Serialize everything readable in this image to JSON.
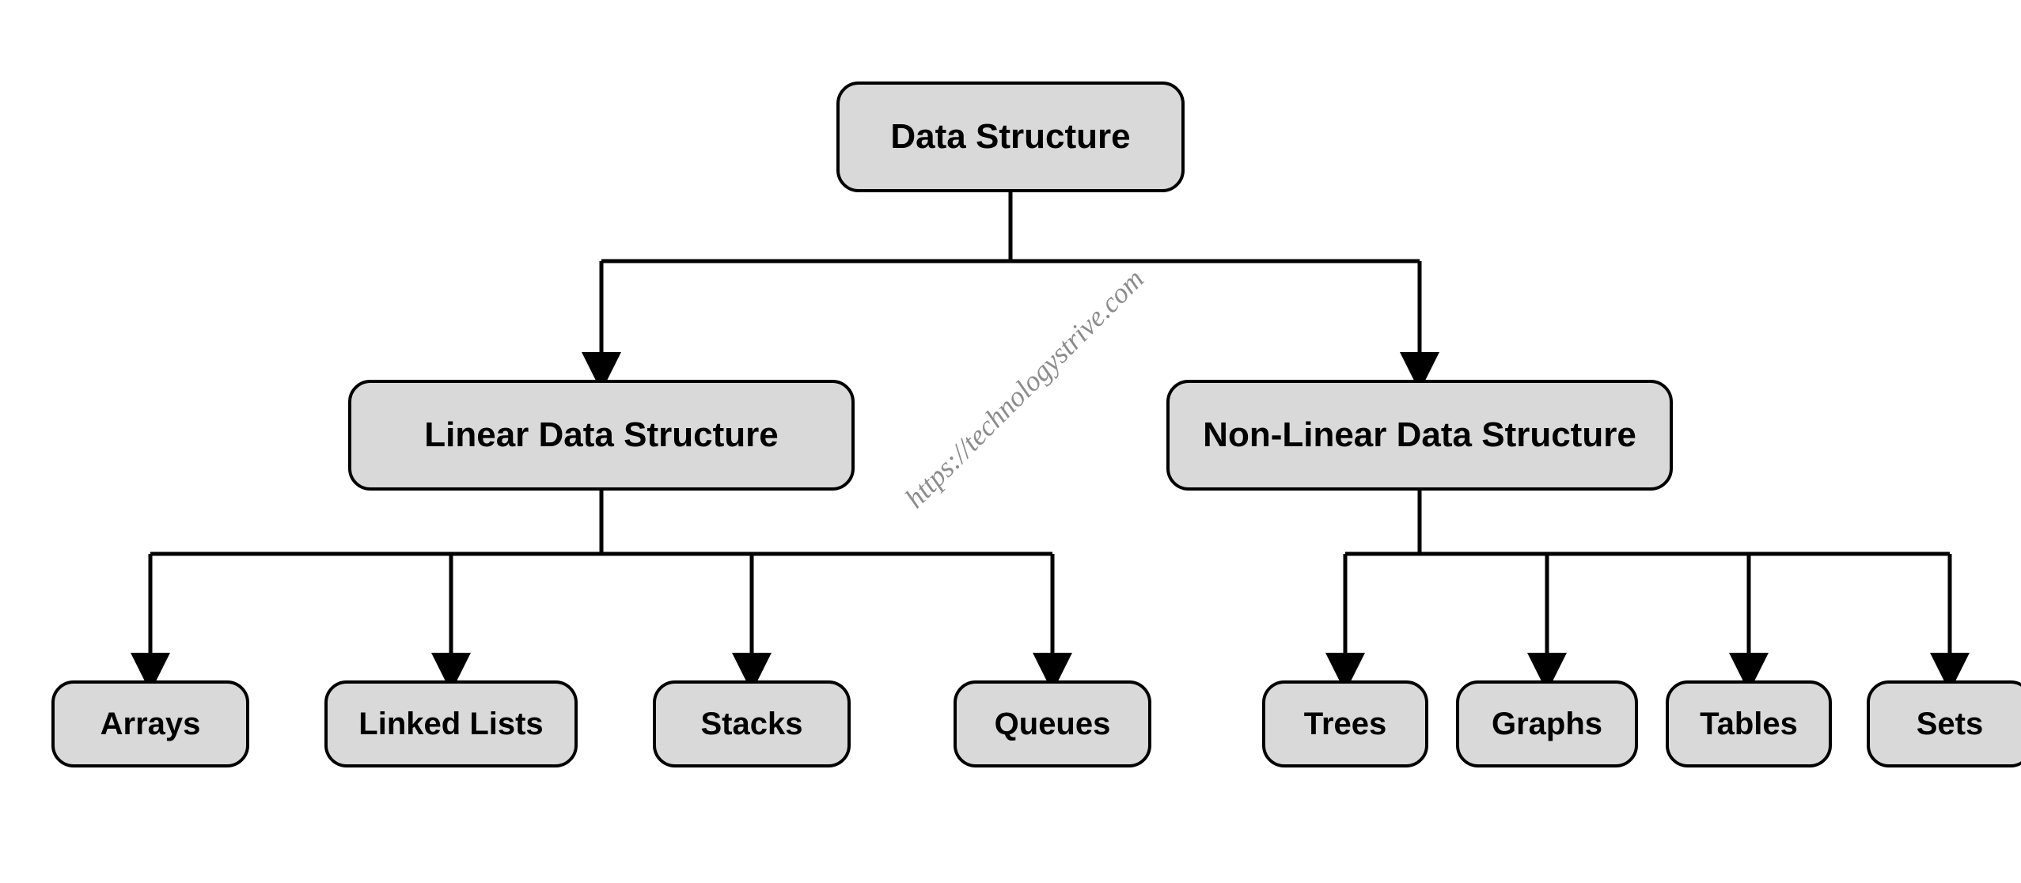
{
  "diagram": {
    "root": {
      "label": "Data Structure"
    },
    "branches": [
      {
        "label": "Linear Data Structure",
        "leaves": [
          {
            "label": "Arrays"
          },
          {
            "label": "Linked Lists"
          },
          {
            "label": "Stacks"
          },
          {
            "label": "Queues"
          }
        ]
      },
      {
        "label": "Non-Linear Data Structure",
        "leaves": [
          {
            "label": "Trees"
          },
          {
            "label": "Graphs"
          },
          {
            "label": "Tables"
          },
          {
            "label": "Sets"
          }
        ]
      }
    ]
  },
  "watermark": "https://technologystrive.com",
  "colors": {
    "node_fill": "#d9d9d9",
    "node_stroke": "#000000",
    "connector": "#000000",
    "watermark": "#808080"
  }
}
